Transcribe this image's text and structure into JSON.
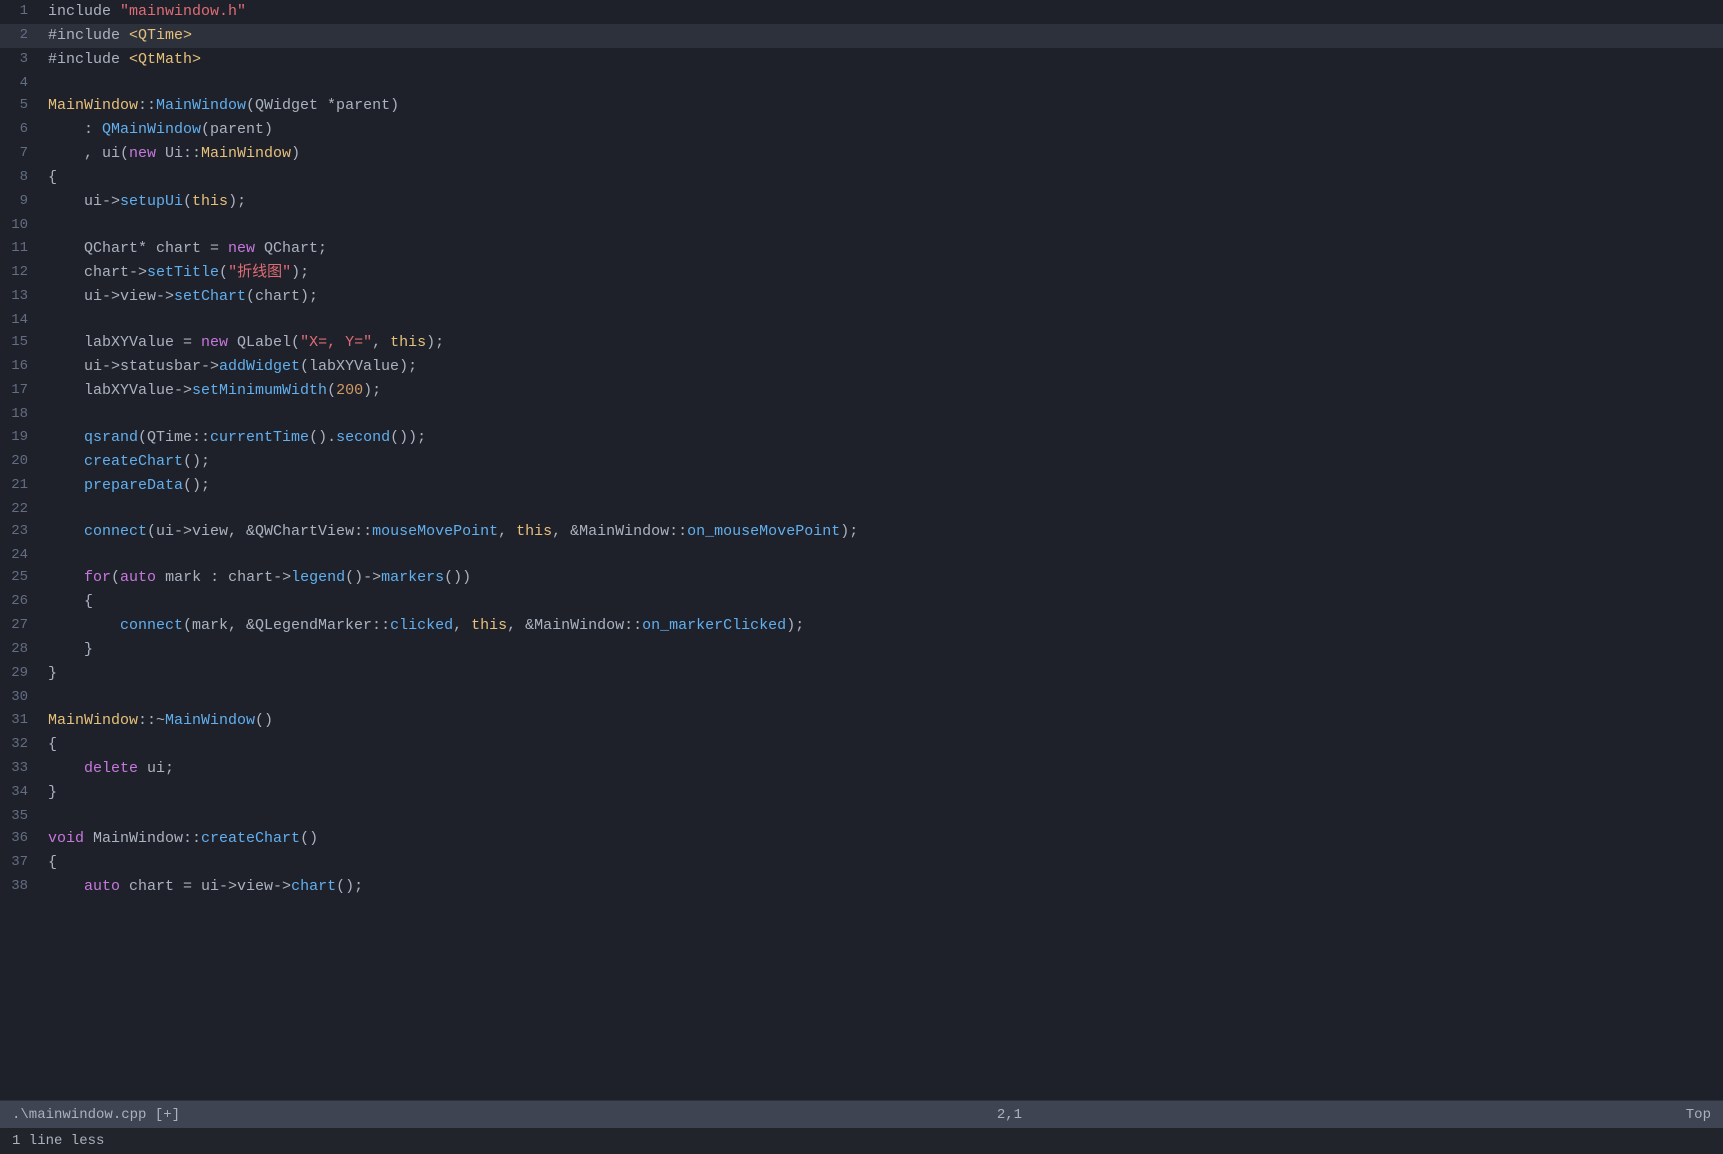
{
  "editor": {
    "filename": ".\\mainwindow.cpp  [+]",
    "cursor_position": "2,1",
    "scroll_position": "Top",
    "bottom_status": "1 line less"
  },
  "lines": [
    {
      "num": 1,
      "highlight": false
    },
    {
      "num": 2,
      "highlight": true
    },
    {
      "num": 3,
      "highlight": false
    },
    {
      "num": 4,
      "highlight": false
    },
    {
      "num": 5,
      "highlight": false
    },
    {
      "num": 6,
      "highlight": false
    },
    {
      "num": 7,
      "highlight": false
    },
    {
      "num": 8,
      "highlight": false
    },
    {
      "num": 9,
      "highlight": false
    },
    {
      "num": 10,
      "highlight": false
    },
    {
      "num": 11,
      "highlight": false
    },
    {
      "num": 12,
      "highlight": false
    },
    {
      "num": 13,
      "highlight": false
    },
    {
      "num": 14,
      "highlight": false
    },
    {
      "num": 15,
      "highlight": false
    },
    {
      "num": 16,
      "highlight": false
    },
    {
      "num": 17,
      "highlight": false
    },
    {
      "num": 18,
      "highlight": false
    },
    {
      "num": 19,
      "highlight": false
    },
    {
      "num": 20,
      "highlight": false
    },
    {
      "num": 21,
      "highlight": false
    },
    {
      "num": 22,
      "highlight": false
    },
    {
      "num": 23,
      "highlight": false
    },
    {
      "num": 24,
      "highlight": false
    },
    {
      "num": 25,
      "highlight": false
    },
    {
      "num": 26,
      "highlight": false
    },
    {
      "num": 27,
      "highlight": false
    },
    {
      "num": 28,
      "highlight": false
    },
    {
      "num": 29,
      "highlight": false
    },
    {
      "num": 30,
      "highlight": false
    },
    {
      "num": 31,
      "highlight": false
    },
    {
      "num": 32,
      "highlight": false
    },
    {
      "num": 33,
      "highlight": false
    },
    {
      "num": 34,
      "highlight": false
    },
    {
      "num": 35,
      "highlight": false
    },
    {
      "num": 36,
      "highlight": false
    },
    {
      "num": 37,
      "highlight": false
    },
    {
      "num": 38,
      "highlight": false
    }
  ]
}
